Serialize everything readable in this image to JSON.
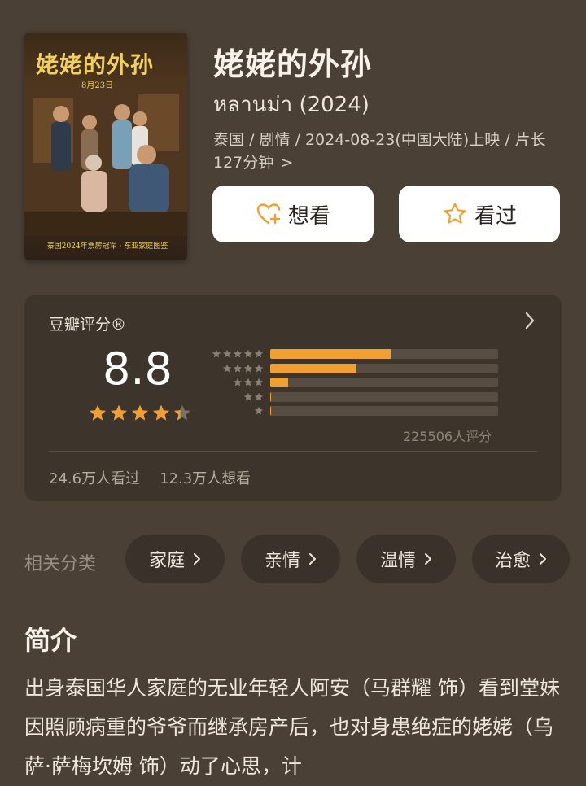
{
  "movie": {
    "title": "姥姥的外孙",
    "original_title": "หลานม่า (2024)",
    "meta_line": "泰国 / 剧情 / 2024-08-23(中国大陆)上映 / 片长127分钟",
    "meta_chevron": ">"
  },
  "poster": {
    "title_art": "姥姥的外孙",
    "date_text": "8月23日",
    "tagline": "泰国2024年票房冠军 · 东亚家庭图鉴"
  },
  "actions": {
    "want_label": "想看",
    "seen_label": "看过"
  },
  "rating": {
    "title": "豆瓣评分®",
    "score": "8.8",
    "star_value": 4.4,
    "distribution": [
      {
        "stars": 5,
        "fraction": 0.53
      },
      {
        "stars": 4,
        "fraction": 0.38
      },
      {
        "stars": 3,
        "fraction": 0.08
      },
      {
        "stars": 2,
        "fraction": 0.005
      },
      {
        "stars": 1,
        "fraction": 0.005
      }
    ],
    "count_text": "225506人评分",
    "seen_text": "24.6万人看过",
    "want_text": "12.3万人想看"
  },
  "categories": {
    "label": "相关分类",
    "items": [
      "家庭",
      "亲情",
      "温情",
      "治愈"
    ]
  },
  "intro": {
    "heading": "简介",
    "text": "出身泰国华人家庭的无业年轻人阿安（马群耀 饰）看到堂妹因照顾病重的爷爷而继承房产后，也对身患绝症的姥姥（乌萨·萨梅坎姆 饰）动了心思，计"
  },
  "colors": {
    "background": "#4a4036",
    "card": "#3d342b",
    "accent": "#f0a032"
  }
}
